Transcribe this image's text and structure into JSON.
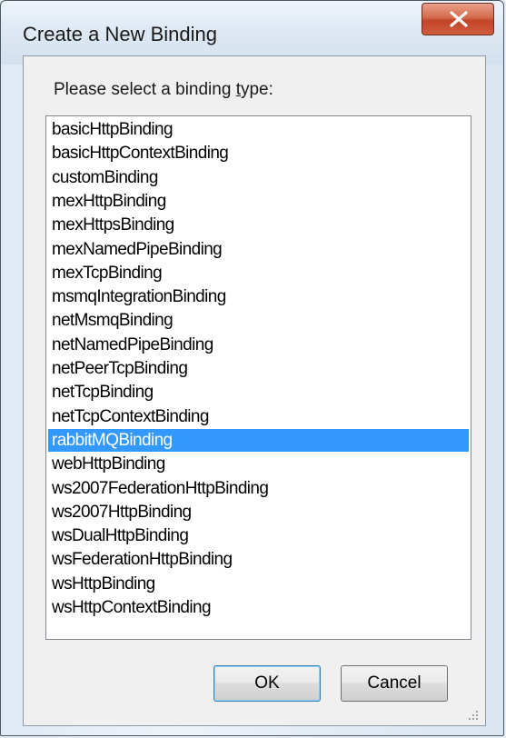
{
  "window": {
    "title": "Create a New Binding"
  },
  "dialog": {
    "prompt_prefix": "Please select a binding ",
    "prompt_mnemonic": "t",
    "prompt_suffix": "ype:",
    "items": [
      "basicHttpBinding",
      "basicHttpContextBinding",
      "customBinding",
      "mexHttpBinding",
      "mexHttpsBinding",
      "mexNamedPipeBinding",
      "mexTcpBinding",
      "msmqIntegrationBinding",
      "netMsmqBinding",
      "netNamedPipeBinding",
      "netPeerTcpBinding",
      "netTcpBinding",
      "netTcpContextBinding",
      "rabbitMQBinding",
      "webHttpBinding",
      "ws2007FederationHttpBinding",
      "ws2007HttpBinding",
      "wsDualHttpBinding",
      "wsFederationHttpBinding",
      "wsHttpBinding",
      "wsHttpContextBinding"
    ],
    "selected_item": "rabbitMQBinding",
    "ok_label": "OK",
    "cancel_label": "Cancel"
  },
  "colors": {
    "selection": "#3399ff",
    "close_button": "#c9503a"
  },
  "icons": {
    "close": "close-icon",
    "resize": "resize-grip-icon"
  }
}
